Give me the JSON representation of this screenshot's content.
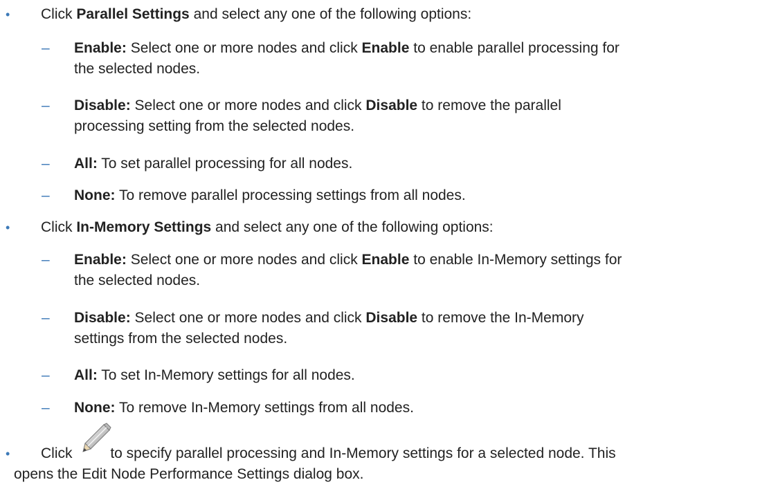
{
  "items": [
    {
      "prefix": "Click ",
      "bold": "Parallel Settings",
      "suffix": " and select any one of the following options:",
      "options": [
        {
          "bold": "Enable:",
          "text_a": " Select one or more nodes and click ",
          "bold2": "Enable",
          "text_b": " to enable parallel processing for",
          "line2": "the selected nodes."
        },
        {
          "bold": "Disable:",
          "text_a": " Select one or more nodes and click ",
          "bold2": "Disable",
          "text_b": " to remove the parallel",
          "line2": "processing setting from the selected nodes."
        },
        {
          "bold": "All:",
          "text": " To set parallel processing for all nodes."
        },
        {
          "bold": "None:",
          "text": " To remove parallel processing settings from all nodes."
        }
      ]
    },
    {
      "prefix": "Click ",
      "bold": "In-Memory Settings",
      "suffix": " and select any one of the following options:",
      "options": [
        {
          "bold": "Enable:",
          "text_a": " Select one or more nodes and click ",
          "bold2": "Enable",
          "text_b": " to enable In-Memory settings for",
          "line2": "the selected nodes."
        },
        {
          "bold": "Disable:",
          "text_a": " Select one or more nodes and click ",
          "bold2": "Disable",
          "text_b": " to remove the In-Memory",
          "line2": "settings from the selected nodes."
        },
        {
          "bold": "All:",
          "text": " To set In-Memory settings for all nodes."
        },
        {
          "bold": "None:",
          "text": " To remove In-Memory settings from all nodes."
        }
      ]
    },
    {
      "prefix": "Click",
      "icon": "pencil-icon",
      "suffix": " to specify parallel processing and In-Memory settings for a selected node. This",
      "line2": "opens the Edit Node Performance Settings dialog box."
    }
  ],
  "marks": {
    "bullet": "•",
    "dash": "–"
  }
}
